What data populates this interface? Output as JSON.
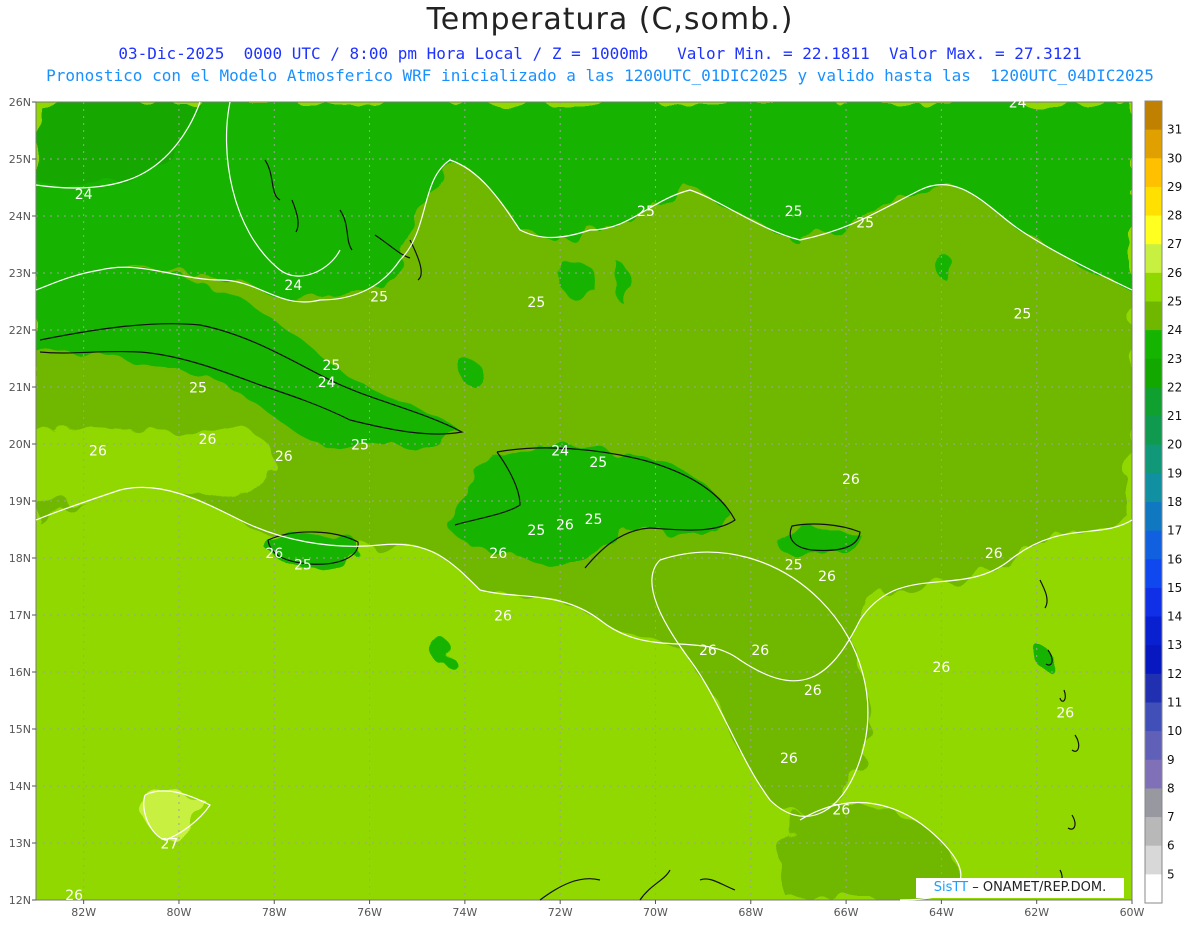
{
  "title": "Temperatura (C,somb.)",
  "subtitle_1": "03-Dic-2025  0000 UTC / 8:00 pm Hora Local / Z = 1000mb   Valor Min. = 22.1811  Valor Max. = 27.3121",
  "subtitle_2": "Pronostico con el Modelo Atmosferico WRF inicializado a las 1200UTC_01DIC2025 y valido hasta las  1200UTC_04DIC2025",
  "credit": {
    "brand": "SisTT",
    "text": "– ONAMET/REP.DOM."
  },
  "map": {
    "lat_labels": [
      "26N",
      "25N",
      "24N",
      "23N",
      "22N",
      "21N",
      "20N",
      "19N",
      "18N",
      "17N",
      "16N",
      "15N",
      "14N",
      "13N",
      "12N"
    ],
    "lon_labels": [
      "82W",
      "80W",
      "78W",
      "76W",
      "74W",
      "72W",
      "70W",
      "68W",
      "66W",
      "64W",
      "62W",
      "60W"
    ],
    "lat_range": [
      12,
      26
    ],
    "lon_range": [
      -83,
      -60
    ],
    "contour_labels": [
      {
        "text": "24",
        "lon": -82.0,
        "lat": 24.3
      },
      {
        "text": "24",
        "lon": -77.6,
        "lat": 22.7
      },
      {
        "text": "24",
        "lon": -76.9,
        "lat": 21.0
      },
      {
        "text": "24",
        "lon": -72.0,
        "lat": 19.8
      },
      {
        "text": "24",
        "lon": -62.4,
        "lat": 25.9
      },
      {
        "text": "25",
        "lon": -75.8,
        "lat": 22.5
      },
      {
        "text": "25",
        "lon": -72.5,
        "lat": 22.4
      },
      {
        "text": "25",
        "lon": -70.2,
        "lat": 24.0
      },
      {
        "text": "25",
        "lon": -67.1,
        "lat": 24.0
      },
      {
        "text": "25",
        "lon": -65.6,
        "lat": 23.8
      },
      {
        "text": "25",
        "lon": -62.3,
        "lat": 22.2
      },
      {
        "text": "25",
        "lon": -76.8,
        "lat": 21.3
      },
      {
        "text": "25",
        "lon": -79.6,
        "lat": 20.9
      },
      {
        "text": "25",
        "lon": -76.2,
        "lat": 19.9
      },
      {
        "text": "25",
        "lon": -71.2,
        "lat": 19.6
      },
      {
        "text": "25",
        "lon": -71.3,
        "lat": 18.6
      },
      {
        "text": "25",
        "lon": -72.5,
        "lat": 18.4
      },
      {
        "text": "25",
        "lon": -77.4,
        "lat": 17.8
      },
      {
        "text": "25",
        "lon": -67.1,
        "lat": 17.8
      },
      {
        "text": "26",
        "lon": -79.4,
        "lat": 20.0
      },
      {
        "text": "26",
        "lon": -81.7,
        "lat": 19.8
      },
      {
        "text": "26",
        "lon": -77.8,
        "lat": 19.7
      },
      {
        "text": "26",
        "lon": -65.9,
        "lat": 19.3
      },
      {
        "text": "26",
        "lon": -78.0,
        "lat": 18.0
      },
      {
        "text": "26",
        "lon": -73.3,
        "lat": 18.0
      },
      {
        "text": "26",
        "lon": -71.9,
        "lat": 18.5
      },
      {
        "text": "26",
        "lon": -73.2,
        "lat": 16.9
      },
      {
        "text": "26",
        "lon": -68.9,
        "lat": 16.3
      },
      {
        "text": "26",
        "lon": -67.8,
        "lat": 16.3
      },
      {
        "text": "26",
        "lon": -66.4,
        "lat": 17.6
      },
      {
        "text": "26",
        "lon": -62.9,
        "lat": 18.0
      },
      {
        "text": "26",
        "lon": -64.0,
        "lat": 16.0
      },
      {
        "text": "26",
        "lon": -66.7,
        "lat": 15.6
      },
      {
        "text": "26",
        "lon": -61.4,
        "lat": 15.2
      },
      {
        "text": "26",
        "lon": -67.2,
        "lat": 14.4
      },
      {
        "text": "26",
        "lon": -66.1,
        "lat": 13.5
      },
      {
        "text": "26",
        "lon": -82.2,
        "lat": 12.0
      },
      {
        "text": "27",
        "lon": -80.2,
        "lat": 12.9
      }
    ]
  },
  "colorbar": {
    "levels": [
      "31",
      "30",
      "29",
      "28",
      "27",
      "26",
      "25",
      "24",
      "23",
      "22",
      "21",
      "20",
      "19",
      "18",
      "17",
      "16",
      "15",
      "14",
      "13",
      "12",
      "11",
      "10",
      "9",
      "8",
      "7",
      "6",
      "5"
    ],
    "colors": [
      "#c08000",
      "#e0a000",
      "#ffc000",
      "#ffe000",
      "#ffff20",
      "#c8f040",
      "#90d800",
      "#70b800",
      "#14b400",
      "#12a800",
      "#10a030",
      "#109a50",
      "#109878",
      "#1090a0",
      "#1078c0",
      "#1060e0",
      "#1048f0",
      "#1030e8",
      "#0820d0",
      "#0818c0",
      "#2030b0",
      "#4050b8",
      "#6060b8",
      "#8070b8",
      "#9898a0",
      "#b8b8b8",
      "#d8d8d8",
      "#ffffff"
    ]
  },
  "field_colors": {
    "t24": "#14b400",
    "t25": "#70b800",
    "t26": "#90d800",
    "t27": "#c8f040",
    "t23": "#12a800",
    "t22": "#109a50"
  }
}
